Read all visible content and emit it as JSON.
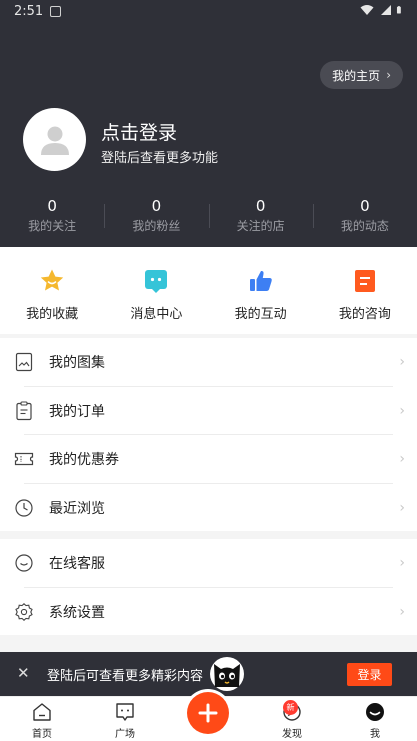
{
  "status_bar": {
    "time": "2:51"
  },
  "header": {
    "home_button": "我的主页",
    "login_title": "点击登录",
    "login_subtitle": "登陆后查看更多功能",
    "stats": [
      {
        "value": "0",
        "label": "我的关注"
      },
      {
        "value": "0",
        "label": "我的粉丝"
      },
      {
        "value": "0",
        "label": "关注的店"
      },
      {
        "value": "0",
        "label": "我的动态"
      }
    ]
  },
  "quick_actions": [
    {
      "label": "我的收藏",
      "icon": "star-icon",
      "color": "#f5b82e"
    },
    {
      "label": "消息中心",
      "icon": "message-icon",
      "color": "#35c4d8"
    },
    {
      "label": "我的互动",
      "icon": "thumbs-up-icon",
      "color": "#3d7ff3"
    },
    {
      "label": "我的咨询",
      "icon": "consult-icon",
      "color": "#ff5a1f"
    }
  ],
  "menu_group_1": [
    {
      "label": "我的图集",
      "icon": "album-icon"
    },
    {
      "label": "我的订单",
      "icon": "clipboard-icon"
    },
    {
      "label": "我的优惠券",
      "icon": "coupon-icon"
    },
    {
      "label": "最近浏览",
      "icon": "clock-icon"
    }
  ],
  "menu_group_2": [
    {
      "label": "在线客服",
      "icon": "chat-bubble-icon"
    },
    {
      "label": "系统设置",
      "icon": "gear-icon"
    }
  ],
  "login_banner": {
    "text": "登陆后可查看更多精彩内容",
    "button": "登录"
  },
  "tabbar": {
    "tabs": [
      {
        "label": "首页",
        "icon": "home-icon"
      },
      {
        "label": "广场",
        "icon": "square-chat-icon"
      },
      {
        "label": "发现",
        "icon": "compass-icon"
      },
      {
        "label": "我",
        "icon": "profile-icon"
      }
    ],
    "badge": "新"
  },
  "colors": {
    "header_bg": "#2f3038",
    "accent": "#ff4a17"
  }
}
